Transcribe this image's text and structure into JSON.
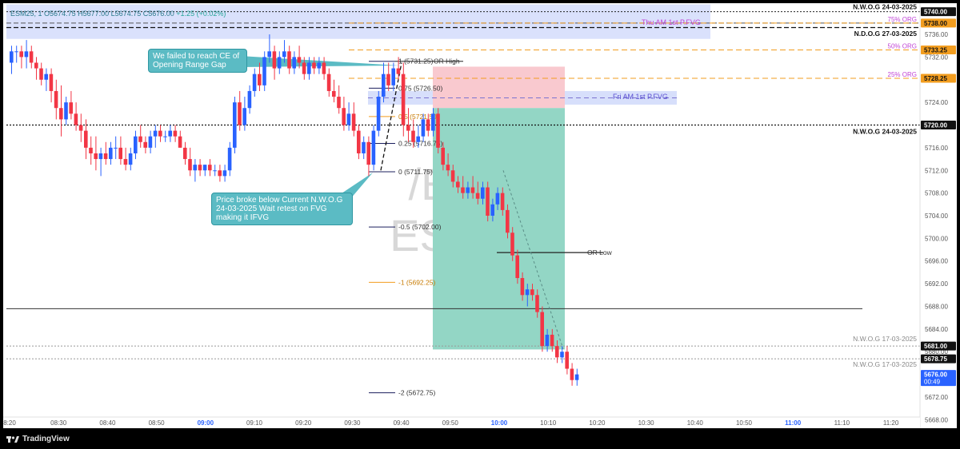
{
  "ticker": {
    "symbol": "ESM25, 1",
    "open": "O5674.75",
    "high": "H5677.00",
    "low": "L5674.75",
    "close": "C5676.00",
    "change": "+1.25 (+0.02%)"
  },
  "watermark": {
    "line1": "/ES1!",
    "line2": "ESM25"
  },
  "notes": {
    "ce": "We failed to reach CE of Opening Range Gap",
    "nwog": "Price broke below Current N.W.O.G 24-03-2025 Wait retest on FVG making it IFVG"
  },
  "footer": {
    "brand": "TradingView"
  },
  "colors": {
    "up": "#2962ff",
    "down": "#f23645",
    "teal_zone": "#93d6c5",
    "red_zone": "#f9c9cf",
    "fvg": "#d3dcfb",
    "orange": "#f29d1f",
    "purple": "#c044d6",
    "axis_text": "#555555",
    "time_bold": "#2962ff"
  },
  "chart_data": {
    "type": "candlestick",
    "ylim": [
      5666.5,
      5741.5
    ],
    "y_ticks": [
      5668,
      5672,
      5676,
      5680,
      5684,
      5688,
      5692,
      5696,
      5700,
      5704,
      5708,
      5712,
      5716,
      5720,
      5724,
      5728,
      5732,
      5736
    ],
    "y_tick_labels": [
      "5668.00",
      "5672.00",
      "5676.00",
      "5680.00",
      "5684.00",
      "5688.00",
      "5692.00",
      "5696.00",
      "5700.00",
      "5704.00",
      "5708.00",
      "5712.00",
      "5716.00",
      "5720.00",
      "5724.00",
      "5728.00",
      "5732.00",
      "5736.00"
    ],
    "x_ticks": [
      "8:20",
      "08:30",
      "08:40",
      "08:50",
      "09:00",
      "09:10",
      "09:20",
      "09:30",
      "09:40",
      "09:50",
      "10:00",
      "10:10",
      "10:20",
      "10:30",
      "10:40",
      "10:50",
      "11:00",
      "11:10",
      "11:20"
    ],
    "x_bold": [
      "09:00",
      "10:00",
      "11:00"
    ],
    "price_tags": [
      {
        "label": "5740.00",
        "price": 5740.0,
        "style": "black"
      },
      {
        "label": "5738.00",
        "price": 5738.0,
        "style": "orange"
      },
      {
        "label": "5733.25",
        "price": 5733.25,
        "style": "orange"
      },
      {
        "label": "5728.25",
        "price": 5728.25,
        "style": "orange"
      },
      {
        "label": "5720.00",
        "price": 5720.0,
        "style": "black"
      },
      {
        "label": "5681.00",
        "price": 5681.0,
        "style": "black"
      },
      {
        "label": "5678.75",
        "price": 5678.75,
        "style": "black"
      },
      {
        "label": "5676.00",
        "price": 5676.0,
        "style": "blue",
        "sub": "00:49"
      }
    ],
    "level_labels": [
      {
        "text": "N.W.O.G 24-03-2025",
        "price": 5740.0,
        "side": "right",
        "style": "bold"
      },
      {
        "text": "N.D.O.G 27-03-2025",
        "price": 5737.3,
        "side": "right",
        "style": "bold"
      },
      {
        "text": "75% ORG",
        "price": 5738.0,
        "side": "right",
        "style": "purple"
      },
      {
        "text": "50% ORG",
        "price": 5733.25,
        "side": "right",
        "style": "purple"
      },
      {
        "text": "25% ORG",
        "price": 5728.25,
        "side": "right",
        "style": "purple"
      },
      {
        "text": "N.W.O.G 24-03-2025",
        "price": 5720.0,
        "side": "right",
        "style": "bold-below"
      },
      {
        "text": "N.W.O.G 17-03-2025",
        "price": 5681.0,
        "side": "right",
        "style": "gray"
      },
      {
        "text": "N.W.O.G 17-03-2025",
        "price": 5678.75,
        "side": "right",
        "style": "gray-below"
      }
    ],
    "zone_labels": [
      {
        "text": "Thu AM 1st P.FVG",
        "price": 5738.1
      },
      {
        "text": "Fri AM 1st P.FVG",
        "price": 5725.0
      }
    ],
    "fib_levels": [
      {
        "label": "1 (5731.25)",
        "price": 5731.25
      },
      {
        "label": "0.75 (5726.50)",
        "price": 5726.5
      },
      {
        "label": "0.5 (5721.50)",
        "price": 5721.5
      },
      {
        "label": "0.25 (5716.75)",
        "price": 5716.75
      },
      {
        "label": "0 (5711.75)",
        "price": 5711.75
      },
      {
        "label": "-0.5 (5702.00)",
        "price": 5702.0
      },
      {
        "label": "-1 (5692.25)",
        "price": 5692.25
      },
      {
        "label": "-2 (5672.75)",
        "price": 5672.75
      }
    ],
    "or_labels": [
      {
        "text": "OR High",
        "price": 5731.25
      },
      {
        "text": "OR Low",
        "price": 5697.5
      }
    ],
    "candles": [
      [
        5731,
        5734,
        5729,
        5733
      ],
      [
        5733,
        5734,
        5731,
        5733
      ],
      [
        5733,
        5734,
        5730,
        5732
      ],
      [
        5732,
        5735,
        5730,
        5733
      ],
      [
        5733,
        5734,
        5730,
        5731
      ],
      [
        5731,
        5732,
        5728,
        5730
      ],
      [
        5730,
        5731,
        5727,
        5728
      ],
      [
        5728,
        5730,
        5726,
        5729
      ],
      [
        5729,
        5730,
        5724,
        5726
      ],
      [
        5726,
        5728,
        5721,
        5723
      ],
      [
        5723,
        5727,
        5718,
        5721
      ],
      [
        5721,
        5725,
        5720,
        5724
      ],
      [
        5724,
        5726,
        5721,
        5722
      ],
      [
        5722,
        5724,
        5719,
        5720
      ],
      [
        5720,
        5722,
        5717,
        5719
      ],
      [
        5719,
        5721,
        5714,
        5716
      ],
      [
        5716,
        5718,
        5713,
        5715
      ],
      [
        5715,
        5718,
        5712,
        5714
      ],
      [
        5714,
        5716,
        5711,
        5715
      ],
      [
        5715,
        5717,
        5713,
        5714
      ],
      [
        5714,
        5717,
        5713,
        5716
      ],
      [
        5716,
        5718,
        5714,
        5716
      ],
      [
        5716,
        5718,
        5713,
        5714
      ],
      [
        5714,
        5716,
        5712,
        5713
      ],
      [
        5713,
        5716,
        5712,
        5715
      ],
      [
        5715,
        5719,
        5714,
        5718
      ],
      [
        5718,
        5720,
        5716,
        5717
      ],
      [
        5717,
        5718,
        5715,
        5716
      ],
      [
        5716,
        5719,
        5715,
        5718
      ],
      [
        5718,
        5720,
        5716,
        5719
      ],
      [
        5719,
        5720,
        5717,
        5718
      ],
      [
        5718,
        5719,
        5717,
        5718
      ],
      [
        5718,
        5720,
        5717,
        5719
      ],
      [
        5719,
        5720,
        5717,
        5718
      ],
      [
        5718,
        5719,
        5716,
        5716
      ],
      [
        5716,
        5717,
        5713,
        5714
      ],
      [
        5714,
        5716,
        5711,
        5712
      ],
      [
        5712,
        5714,
        5710,
        5713
      ],
      [
        5713,
        5714,
        5711,
        5712
      ],
      [
        5712,
        5713,
        5711,
        5713
      ],
      [
        5713,
        5714,
        5711,
        5712
      ],
      [
        5712,
        5713,
        5711,
        5712
      ],
      [
        5712,
        5713,
        5710,
        5711
      ],
      [
        5711,
        5713,
        5710,
        5712
      ],
      [
        5712,
        5717,
        5711,
        5716
      ],
      [
        5716,
        5725,
        5715,
        5724
      ],
      [
        5724,
        5726,
        5719,
        5720
      ],
      [
        5720,
        5725,
        5719,
        5723
      ],
      [
        5723,
        5727,
        5722,
        5726
      ],
      [
        5726,
        5730,
        5725,
        5729
      ],
      [
        5729,
        5731,
        5726,
        5727
      ],
      [
        5727,
        5733,
        5726,
        5732
      ],
      [
        5732,
        5736,
        5731,
        5733
      ],
      [
        5733,
        5734,
        5728,
        5730
      ],
      [
        5730,
        5733,
        5729,
        5732
      ],
      [
        5732,
        5735,
        5731,
        5733
      ],
      [
        5733,
        5734,
        5729,
        5730
      ],
      [
        5730,
        5733,
        5729,
        5732
      ],
      [
        5732,
        5734,
        5730,
        5731
      ],
      [
        5731,
        5732,
        5728,
        5729
      ],
      [
        5729,
        5732,
        5728,
        5731
      ],
      [
        5731,
        5732,
        5729,
        5730
      ],
      [
        5730,
        5732,
        5729,
        5731
      ],
      [
        5731,
        5732,
        5728,
        5729
      ],
      [
        5729,
        5730,
        5725,
        5726
      ],
      [
        5726,
        5728,
        5724,
        5725
      ],
      [
        5725,
        5727,
        5722,
        5723
      ],
      [
        5723,
        5725,
        5719,
        5720
      ],
      [
        5720,
        5724,
        5719,
        5722
      ],
      [
        5722,
        5724,
        5718,
        5719
      ],
      [
        5719,
        5720,
        5714,
        5715
      ],
      [
        5715,
        5718,
        5714,
        5717
      ],
      [
        5717,
        5718,
        5711,
        5713
      ],
      [
        5713,
        5720,
        5712,
        5719
      ],
      [
        5719,
        5726,
        5718,
        5725
      ],
      [
        5725,
        5731,
        5724,
        5729
      ],
      [
        5729,
        5731,
        5726,
        5727
      ],
      [
        5727,
        5731,
        5726,
        5730
      ],
      [
        5730,
        5732,
        5728,
        5729
      ],
      [
        5729,
        5731,
        5718,
        5720
      ],
      [
        5720,
        5723,
        5717,
        5719
      ],
      [
        5719,
        5721,
        5716,
        5717
      ],
      [
        5717,
        5720,
        5716,
        5718
      ],
      [
        5718,
        5722,
        5717,
        5721
      ],
      [
        5721,
        5722,
        5718,
        5719
      ],
      [
        5719,
        5723,
        5718,
        5722
      ],
      [
        5722,
        5723,
        5715,
        5716
      ],
      [
        5716,
        5717,
        5712,
        5713
      ],
      [
        5713,
        5715,
        5711,
        5712
      ],
      [
        5712,
        5713,
        5709,
        5710
      ],
      [
        5710,
        5711,
        5708,
        5709
      ],
      [
        5709,
        5711,
        5707,
        5708
      ],
      [
        5708,
        5710,
        5707,
        5709
      ],
      [
        5709,
        5711,
        5707,
        5708
      ],
      [
        5708,
        5710,
        5706,
        5707
      ],
      [
        5707,
        5710,
        5706,
        5709
      ],
      [
        5709,
        5710,
        5703,
        5704
      ],
      [
        5704,
        5707,
        5703,
        5706
      ],
      [
        5706,
        5709,
        5705,
        5708
      ],
      [
        5708,
        5709,
        5704,
        5705
      ],
      [
        5705,
        5706,
        5700,
        5701
      ],
      [
        5701,
        5702,
        5696,
        5697
      ],
      [
        5697,
        5698,
        5692,
        5693
      ],
      [
        5693,
        5694,
        5689,
        5690
      ],
      [
        5690,
        5692,
        5688,
        5691
      ],
      [
        5691,
        5692,
        5689,
        5690
      ],
      [
        5690,
        5691,
        5686,
        5687
      ],
      [
        5687,
        5688,
        5680,
        5681
      ],
      [
        5681,
        5684,
        5680,
        5683
      ],
      [
        5683,
        5684,
        5680,
        5681
      ],
      [
        5681,
        5682,
        5678,
        5679
      ],
      [
        5679,
        5681,
        5678,
        5680
      ],
      [
        5680,
        5681,
        5676,
        5677
      ],
      [
        5677,
        5678,
        5674,
        5675
      ],
      [
        5675,
        5677,
        5674,
        5676
      ]
    ]
  }
}
